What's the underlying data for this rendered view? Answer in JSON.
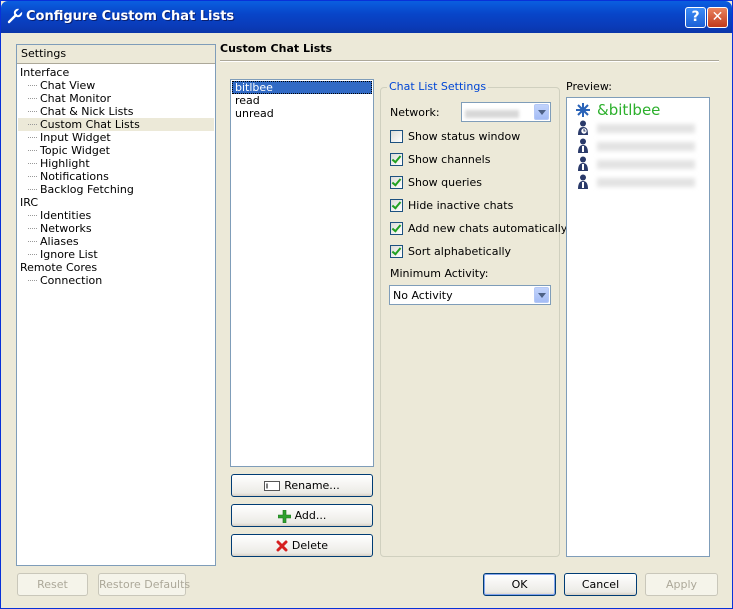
{
  "window": {
    "title": "Configure Custom Chat Lists",
    "help_label": "?",
    "close_label": "✕"
  },
  "settings_tree": {
    "header": "Settings",
    "groups": [
      {
        "label": "Interface",
        "children": [
          "Chat View",
          "Chat Monitor",
          "Chat & Nick Lists",
          "Custom Chat Lists",
          "Input Widget",
          "Topic Widget",
          "Highlight",
          "Notifications",
          "Backlog Fetching"
        ]
      },
      {
        "label": "IRC",
        "children": [
          "Identities",
          "Networks",
          "Aliases",
          "Ignore List"
        ]
      },
      {
        "label": "Remote Cores",
        "children": [
          "Connection"
        ]
      }
    ],
    "selected": "Custom Chat Lists"
  },
  "page": {
    "title": "Custom Chat Lists"
  },
  "chat_lists": {
    "items": [
      "bitlbee",
      "read",
      "unread"
    ],
    "selected": "bitlbee"
  },
  "list_buttons": {
    "rename": "Rename...",
    "add": "Add...",
    "delete": "Delete"
  },
  "chat_list_settings": {
    "title": "Chat List Settings",
    "network_label": "Network:",
    "checkboxes": [
      {
        "label": "Show status window",
        "checked": false
      },
      {
        "label": "Show channels",
        "checked": true
      },
      {
        "label": "Show queries",
        "checked": true
      },
      {
        "label": "Hide inactive chats",
        "checked": true
      },
      {
        "label": "Add new chats automatically",
        "checked": true
      },
      {
        "label": "Sort alphabetically",
        "checked": true
      }
    ],
    "min_activity_label": "Minimum Activity:",
    "min_activity_value": "No Activity"
  },
  "preview": {
    "title": "Preview:",
    "network_name": "&bitlbee",
    "accent": "#2db02d"
  },
  "footer": {
    "reset": "Reset",
    "restore_defaults": "Restore Defaults",
    "ok": "OK",
    "cancel": "Cancel",
    "apply": "Apply"
  }
}
